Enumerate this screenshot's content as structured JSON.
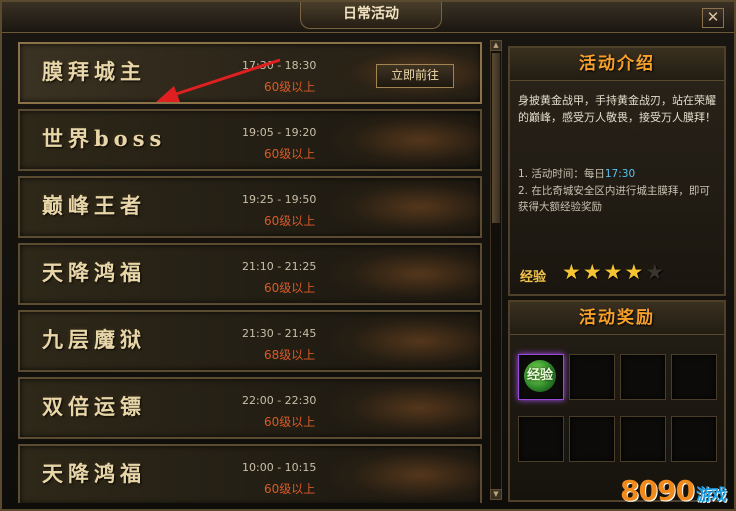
{
  "window": {
    "title": "日常活动",
    "close_label": "✕"
  },
  "activities": [
    {
      "name": "膜拜城主",
      "time": "17:30 - 18:30",
      "level": "60级以上",
      "button": "立即前往",
      "selected": true
    },
    {
      "name": "世界boss",
      "time": "19:05 - 19:20",
      "level": "60级以上"
    },
    {
      "name": "巅峰王者",
      "time": "19:25 - 19:50",
      "level": "60级以上"
    },
    {
      "name": "天降鸿福",
      "time": "21:10 - 21:25",
      "level": "60级以上"
    },
    {
      "name": "九层魔狱",
      "time": "21:30 - 21:45",
      "level": "68级以上"
    },
    {
      "name": "双倍运镖",
      "time": "22:00 - 22:30",
      "level": "60级以上"
    },
    {
      "name": "天降鸿福",
      "time": "10:00 - 10:15",
      "level": "60级以上"
    }
  ],
  "intro": {
    "header": "活动介绍",
    "description": "身披黄金战甲，手持黄金战刃，站在荣耀的巅峰，感受万人敬畏，接受万人膜拜！",
    "rule1_prefix": "1. 活动时间：每日",
    "rule1_time": "17:30",
    "rule2": "2. 在比奇城安全区内进行城主膜拜，即可获得大额经验奖励",
    "exp_label": "经验",
    "stars_filled": 4,
    "stars_total": 5
  },
  "rewards": {
    "header": "活动奖励",
    "items": [
      "经验"
    ]
  },
  "watermark": {
    "number": "8090",
    "text": "游戏"
  },
  "colors": {
    "accent": "#f7a02a",
    "level": "#d85a28",
    "highlight": "#57c4f0"
  }
}
